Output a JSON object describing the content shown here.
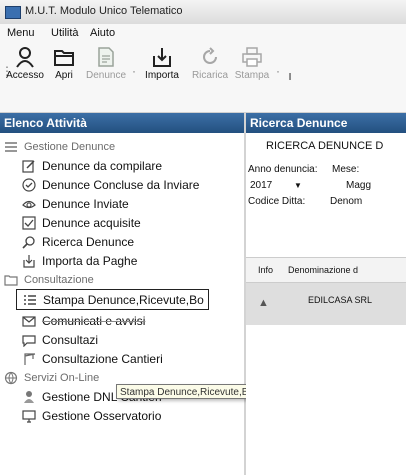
{
  "window": {
    "title": "M.U.T. Modulo Unico Telematico"
  },
  "menu": [
    "Menu",
    "Utilità",
    "Aiuto"
  ],
  "toolbar": {
    "buttons": [
      {
        "label": "Accesso",
        "icon": "user-icon",
        "enabled": true
      },
      {
        "label": "Apri",
        "icon": "folder-icon",
        "enabled": true
      },
      {
        "label": "Denunce",
        "icon": "document-icon",
        "enabled": false
      },
      {
        "label": "Importa",
        "icon": "import-icon",
        "enabled": true
      },
      {
        "label": "Ricarica",
        "icon": "refresh-icon",
        "enabled": false
      },
      {
        "label": "Stampa",
        "icon": "printer-icon",
        "enabled": false
      },
      {
        "label": "I",
        "icon": "",
        "enabled": true
      }
    ]
  },
  "left_panel": {
    "title": "Elenco Attività",
    "groups": [
      {
        "label": "Gestione Denunce",
        "icon": "list-icon",
        "items": [
          {
            "label": "Denunce da compilare",
            "icon": "edit-icon"
          },
          {
            "label": "Denunce Concluse da Inviare",
            "icon": "check-circle-icon"
          },
          {
            "label": "Denunce Inviate",
            "icon": "send-icon"
          },
          {
            "label": "Denunce acquisite",
            "icon": "checkbox-icon"
          },
          {
            "label": "Ricerca Denunce",
            "icon": "search-icon"
          },
          {
            "label": "Importa da Paghe",
            "icon": "import-icon"
          }
        ]
      },
      {
        "label": "Consultazione",
        "icon": "folder-icon",
        "items": [
          {
            "label": "Stampa Denunce,Ricevute,Bo",
            "icon": "print-list-icon",
            "selected": true
          },
          {
            "label": "Comunicati e avvisi",
            "icon": "mail-icon"
          },
          {
            "label": "Consultazi",
            "icon": "message-icon"
          },
          {
            "label": "Consultazione Cantieri",
            "icon": "crane-icon"
          }
        ]
      },
      {
        "label": "Servizi On-Line",
        "icon": "globe-icon",
        "items": [
          {
            "label": "Gestione DNL Cantieri",
            "icon": "worker-icon"
          },
          {
            "label": "Gestione Osservatorio",
            "icon": "monitor-icon"
          }
        ]
      }
    ],
    "tooltip": "Stampa Denunce,Ricevute,Bollettini"
  },
  "right_panel": {
    "title": "Ricerca Denunce",
    "heading": "RICERCA DENUNCE D",
    "anno_label": "Anno denuncia:",
    "anno_value": "2017",
    "mese_label": "Mese:",
    "mese_value": "Magg",
    "codice_label": "Codice Ditta:",
    "denom_label": "Denom",
    "grid_headers": [
      "Info",
      "Denominazione d"
    ],
    "grid_row": {
      "name": "EDILCASA SRL"
    }
  }
}
